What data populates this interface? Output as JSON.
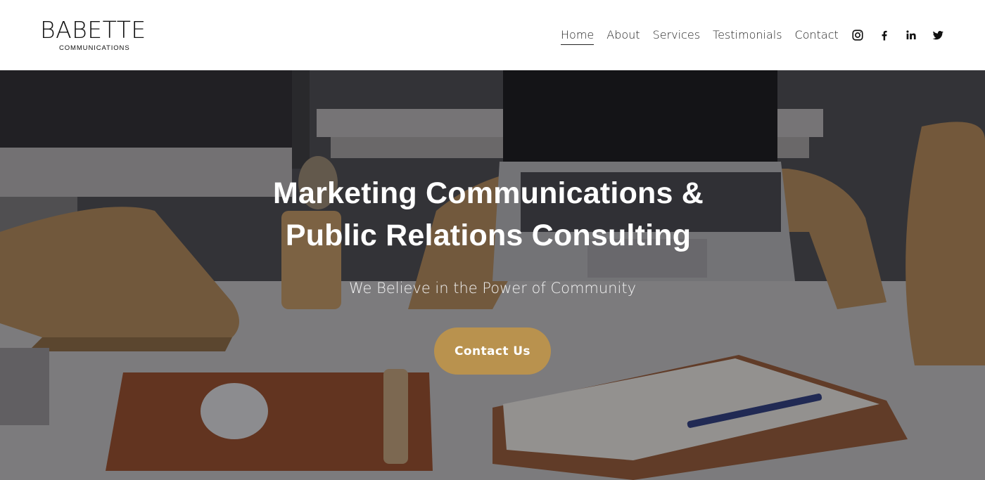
{
  "brand": {
    "name": "BABETTE",
    "tagline": "COMMUNICATIONS"
  },
  "nav": {
    "items": [
      {
        "label": "Home",
        "active": true
      },
      {
        "label": "About",
        "active": false
      },
      {
        "label": "Services",
        "active": false
      },
      {
        "label": "Testimonials",
        "active": false
      },
      {
        "label": "Contact",
        "active": false
      }
    ]
  },
  "social": [
    {
      "icon": "instagram-icon"
    },
    {
      "icon": "facebook-icon"
    },
    {
      "icon": "linkedin-icon"
    },
    {
      "icon": "twitter-icon"
    }
  ],
  "hero": {
    "title_line1": "Marketing Communications &",
    "title_line2": "Public Relations Consulting",
    "subtitle": "We Believe in the Power of Community",
    "cta_label": "Contact Us"
  },
  "colors": {
    "accent": "#b9924e",
    "nav_text": "#222222",
    "header_bg": "#ffffff"
  }
}
